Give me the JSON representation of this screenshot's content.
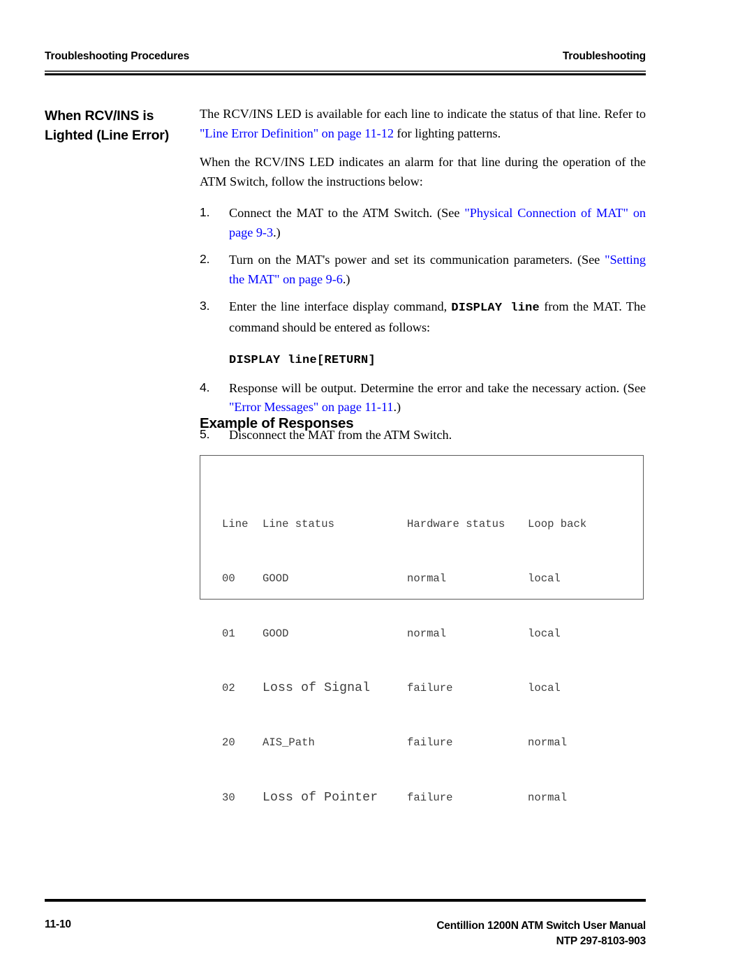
{
  "header": {
    "left": "Troubleshooting Procedures",
    "right": "Troubleshooting"
  },
  "side_heading": "When RCV/INS is Lighted (Line Error)",
  "body": {
    "para1_a": "The RCV/INS LED is available for each line to indicate the status of that line. Refer to ",
    "para1_link": "\"Line Error Definition\" on page 11-12",
    "para1_b": " for lighting patterns.",
    "para2": "When the RCV/INS LED indicates an alarm for that line during the operation of the ATM Switch, follow the instructions below:"
  },
  "steps": [
    {
      "num": "1.",
      "text_a": "Connect the MAT to the ATM Switch. (See ",
      "link": "\"Physical Connection of MAT\" on page 9-3",
      "text_b": ".)"
    },
    {
      "num": "2.",
      "text_a": "Turn on the MAT's power and set its communication parameters. (See ",
      "link": "\"Setting the MAT\" on page 9-6",
      "text_b": ".)"
    },
    {
      "num": "3.",
      "text_a": "Enter the line interface display command, ",
      "command": "DISPLAY line",
      "text_b": " from the MAT. The command should be entered as follows:",
      "command_block": "DISPLAY line[RETURN]"
    },
    {
      "num": "4.",
      "text_a": "Response will be output. Determine the error and take the necessary action. (See ",
      "link": "\"Error Messages\" on page 11-11",
      "text_b": ".)"
    },
    {
      "num": "5.",
      "text_a": "Disconnect the MAT from the ATM Switch.",
      "link": "",
      "text_b": ""
    }
  ],
  "sub_heading": "Example of Responses",
  "response_table": {
    "headers": {
      "line": "Line",
      "status": "Line status",
      "hardware": "Hardware status",
      "loopback": "Loop back"
    },
    "rows": [
      {
        "line": "00",
        "status": "GOOD",
        "hardware": "normal",
        "loopback": "local",
        "emphasis": false
      },
      {
        "line": "01",
        "status": "GOOD",
        "hardware": "normal",
        "loopback": "local",
        "emphasis": false
      },
      {
        "line": "02",
        "status": "Loss of Signal",
        "hardware": "failure",
        "loopback": "local",
        "emphasis": true
      },
      {
        "line": "20",
        "status": "AIS_Path",
        "hardware": "failure",
        "loopback": "normal",
        "emphasis": false
      },
      {
        "line": "30",
        "status": "Loss of Pointer",
        "hardware": "failure",
        "loopback": "normal",
        "emphasis": true
      }
    ]
  },
  "footer": {
    "page_number": "11-10",
    "manual_title": "Centillion 1200N ATM Switch User Manual",
    "document_number": "NTP 297-8103-903"
  },
  "colors": {
    "link": "#0000FF",
    "rule": "#000000",
    "box_border": "#5A5A5A",
    "code_text": "#3D3D3D"
  }
}
